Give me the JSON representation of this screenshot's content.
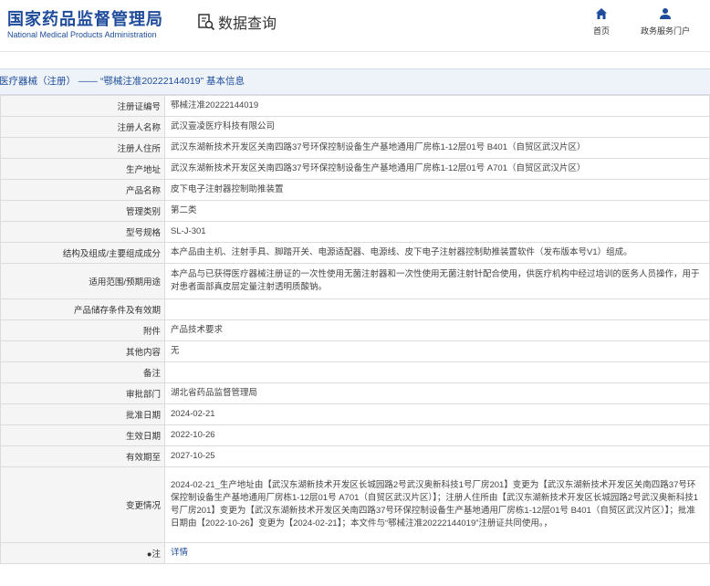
{
  "header": {
    "logo_cn": "国家药品监督管理局",
    "logo_en": "National Medical Products Administration",
    "query_label": "数据查询",
    "nav_home": "首页",
    "nav_services": "政务服务门户"
  },
  "breadcrumb": "医疗器械（注册） —— “鄂械注准20222144019” 基本信息",
  "rows": [
    {
      "label": "注册证编号",
      "value": "鄂械注准20222144019"
    },
    {
      "label": "注册人名称",
      "value": "武汉壹凌医疗科技有限公司"
    },
    {
      "label": "注册人住所",
      "value": "武汉东湖新技术开发区关南四路37号环保控制设备生产基地通用厂房栋1-12层01号 B401（自贸区武汉片区）"
    },
    {
      "label": "生产地址",
      "value": "武汉东湖新技术开发区关南四路37号环保控制设备生产基地通用厂房栋1-12层01号 A701（自贸区武汉片区）"
    },
    {
      "label": "产品名称",
      "value": "皮下电子注射器控制助推装置"
    },
    {
      "label": "管理类别",
      "value": "第二类"
    },
    {
      "label": "型号规格",
      "value": "SL-J-301"
    },
    {
      "label": "结构及组成/主要组成成分",
      "value": "本产品由主机、注射手具、脚踏开关、电源适配器、电源线、皮下电子注射器控制助推装置软件（发布版本号V1）组成。"
    },
    {
      "label": "适用范围/预期用途",
      "value": "本产品与已获得医疗器械注册证的一次性使用无菌注射器和一次性使用无菌注射针配合使用，供医疗机构中经过培训的医务人员操作，用于对患者面部真皮层定量注射透明质酸钠。"
    },
    {
      "label": "产品储存条件及有效期",
      "value": ""
    },
    {
      "label": "附件",
      "value": "产品技术要求"
    },
    {
      "label": "其他内容",
      "value": "无"
    },
    {
      "label": "备注",
      "value": ""
    },
    {
      "label": "审批部门",
      "value": "湖北省药品监督管理局"
    },
    {
      "label": "批准日期",
      "value": "2024-02-21"
    },
    {
      "label": "生效日期",
      "value": "2022-10-26"
    },
    {
      "label": "有效期至",
      "value": "2027-10-25"
    },
    {
      "label": "变更情况",
      "value": "2024-02-21_生产地址由【武汉东湖新技术开发区长城园路2号武汉奥新科技1号厂房201】变更为【武汉东湖新技术开发区关南四路37号环保控制设备生产基地通用厂房栋1-12层01号 A701（自贸区武汉片区）】；注册人住所由【武汉东湖新技术开发区长城园路2号武汉奥新科技1号厂房201】变更为【武汉东湖新技术开发区关南四路37号环保控制设备生产基地通用厂房栋1-12层01号 B401（自贸区武汉片区）】；批准日期由【2022-10-26】变更为【2024-02-21】；本文件与“鄂械注准20222144019”注册证共同使用。，"
    },
    {
      "label": "●注",
      "value": "详情"
    }
  ],
  "colors": {
    "brand": "#1e4c9a",
    "label_bg": "#f5f5f5",
    "crumb_bg": "#eef3f9"
  },
  "icons": {
    "query": "search-document-icon",
    "home": "home-icon",
    "services": "user-icon"
  }
}
